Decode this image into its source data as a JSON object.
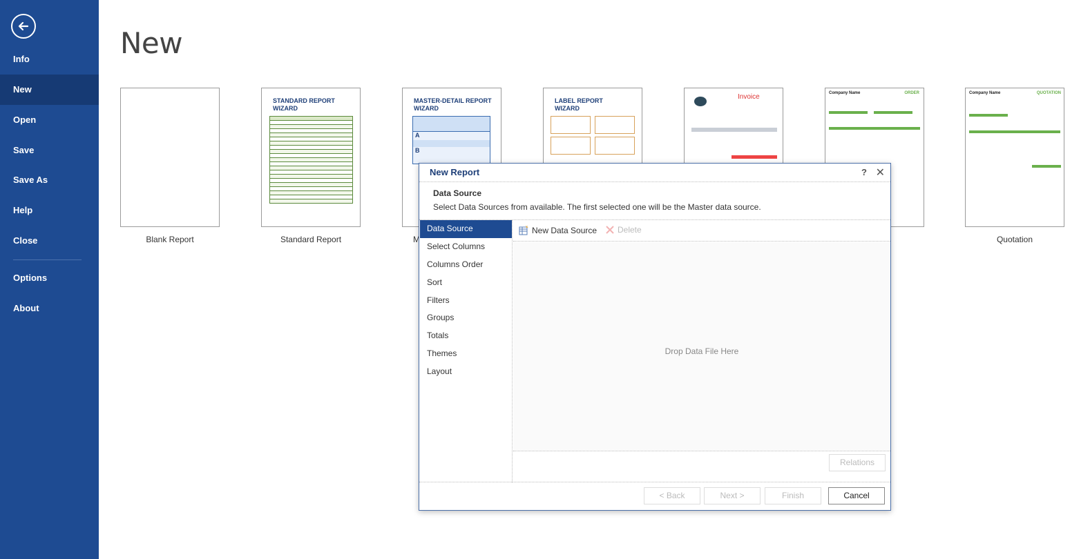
{
  "sidebar": {
    "back_icon": "back-arrow-icon",
    "items": [
      {
        "label": "Info"
      },
      {
        "label": "New"
      },
      {
        "label": "Open"
      },
      {
        "label": "Save"
      },
      {
        "label": "Save As"
      },
      {
        "label": "Help"
      },
      {
        "label": "Close"
      },
      {
        "label": "Options"
      },
      {
        "label": "About"
      }
    ],
    "active": "New"
  },
  "page": {
    "title": "New"
  },
  "templates": [
    {
      "label": "Blank Report"
    },
    {
      "label": "Standard Report",
      "thumb_title": "STANDARD REPORT WIZARD"
    },
    {
      "label": "M",
      "thumb_title": "MASTER-DETAIL REPORT WIZARD"
    },
    {
      "label": "",
      "thumb_title": "LABEL REPORT WIZARD"
    },
    {
      "label": "",
      "thumb_title": "Invoice"
    },
    {
      "label": "",
      "thumb_title": "Company Name",
      "thumb_tag": "ORDER"
    },
    {
      "label": "Quotation",
      "thumb_title": "Company Name",
      "thumb_tag": "QUOTATION"
    }
  ],
  "dialog": {
    "title": "New Report",
    "help": "?",
    "close": "✕",
    "section_title": "Data Source",
    "section_desc": "Select Data Sources from available. The first selected one will be the Master data source.",
    "steps": [
      "Data Source",
      "Select Columns",
      "Columns Order",
      "Sort",
      "Filters",
      "Groups",
      "Totals",
      "Themes",
      "Layout"
    ],
    "active_step": "Data Source",
    "toolbar": {
      "new_data_source": "New Data Source",
      "delete": "Delete"
    },
    "drop_text": "Drop Data File Here",
    "relations": "Relations",
    "buttons": {
      "back": "< Back",
      "next": "Next >",
      "finish": "Finish",
      "cancel": "Cancel"
    }
  },
  "colors": {
    "sidebar_bg": "#1e4b92",
    "sidebar_active": "#163a74",
    "accent_text": "#1e3f78"
  }
}
